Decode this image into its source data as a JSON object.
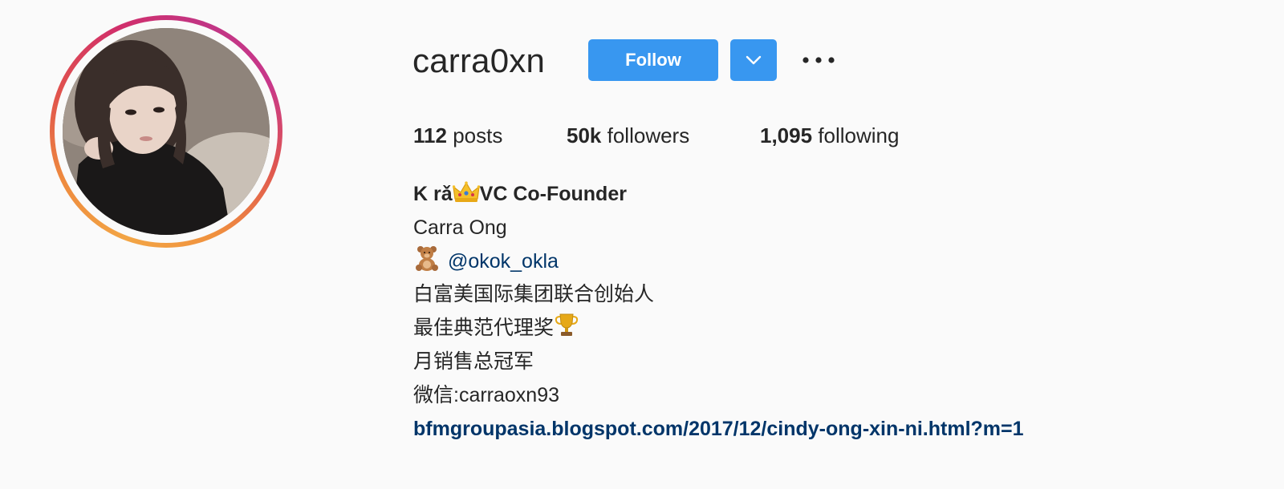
{
  "profile": {
    "username": "carra0xn",
    "follow_label": "Follow",
    "dropdown_icon": "chevron-down-icon",
    "more_icon": "more-options-icon"
  },
  "stats": {
    "posts_count": "112",
    "posts_label": "posts",
    "followers_count": "50k",
    "followers_label": "followers",
    "following_count": "1,095",
    "following_label": "following"
  },
  "bio": {
    "display_name_prefix": "K rǎ",
    "display_name_suffix": "VC Co-Founder",
    "full_name": "Carra Ong",
    "mention": "@okok_okla",
    "line_1": "白富美国际集团联合创始人",
    "line_2": "最佳典范代理奖",
    "line_3": "月销售总冠军",
    "line_4": "微信:carraoxn93",
    "website": "bfmgroupasia.blogspot.com/2017/12/cindy-ong-xin-ni.html?m=1"
  },
  "icons": {
    "crown": "crown-icon",
    "teddy_bear": "teddy-bear-icon",
    "trophy": "trophy-icon"
  },
  "colors": {
    "button_blue": "#3897f0",
    "link_blue": "#003569",
    "text": "#262626",
    "background": "#fafafa"
  }
}
